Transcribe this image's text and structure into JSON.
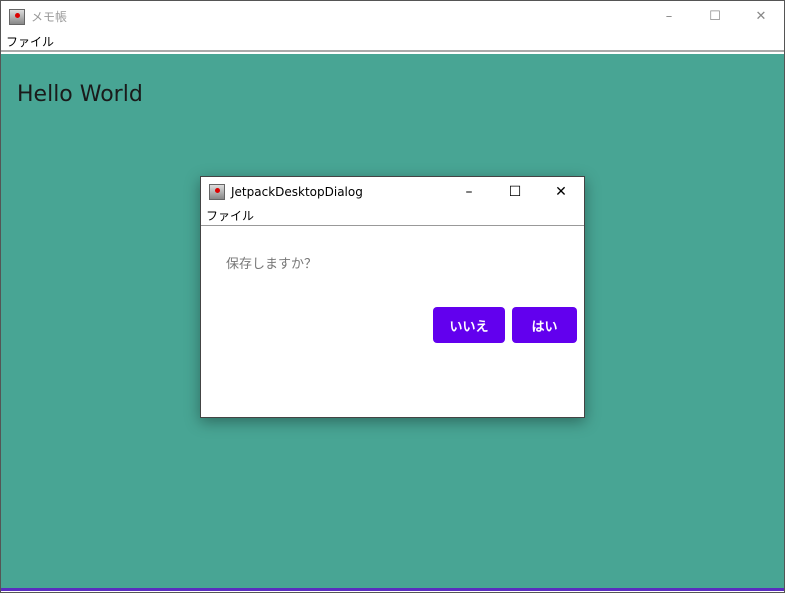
{
  "main_window": {
    "title": "メモ帳",
    "menu": [
      "ファイル"
    ],
    "content_text": "Hello World",
    "background": "#48a594"
  },
  "dialog": {
    "title": "JetpackDesktopDialog",
    "menu": [
      "ファイル"
    ],
    "message": "保存しますか？",
    "no_label": "いいえ",
    "yes_label": "はい",
    "button_color": "#6200ee"
  },
  "controls": {
    "minimize": "–",
    "maximize": "☐",
    "close": "✕"
  }
}
